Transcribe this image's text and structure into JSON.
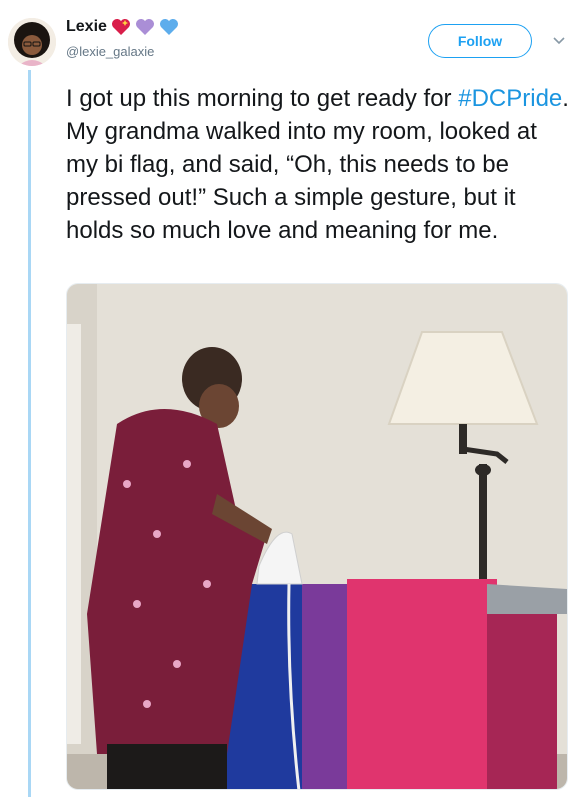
{
  "user": {
    "display_name": "Lexie",
    "handle": "@lexie_galaxie",
    "name_emojis": [
      "sparkling-heart",
      "purple-heart",
      "blue-heart"
    ]
  },
  "follow_label": "Follow",
  "tweet": {
    "text_before": "I got up this morning to get ready for ",
    "hashtag": "#DCPride",
    "text_after": ". My grandma walked into my room, looked at my bi flag, and said, “Oh, this needs to be pressed out!” Such a simple gesture, but it holds so much love and meaning for me."
  },
  "colors": {
    "link": "#1b95e0",
    "follow_blue": "#1da1f2",
    "thread_line": "#a9d7f5",
    "flag_pink": "#e0346e",
    "flag_purple": "#7a3a9a",
    "flag_blue": "#1f3a9e"
  }
}
